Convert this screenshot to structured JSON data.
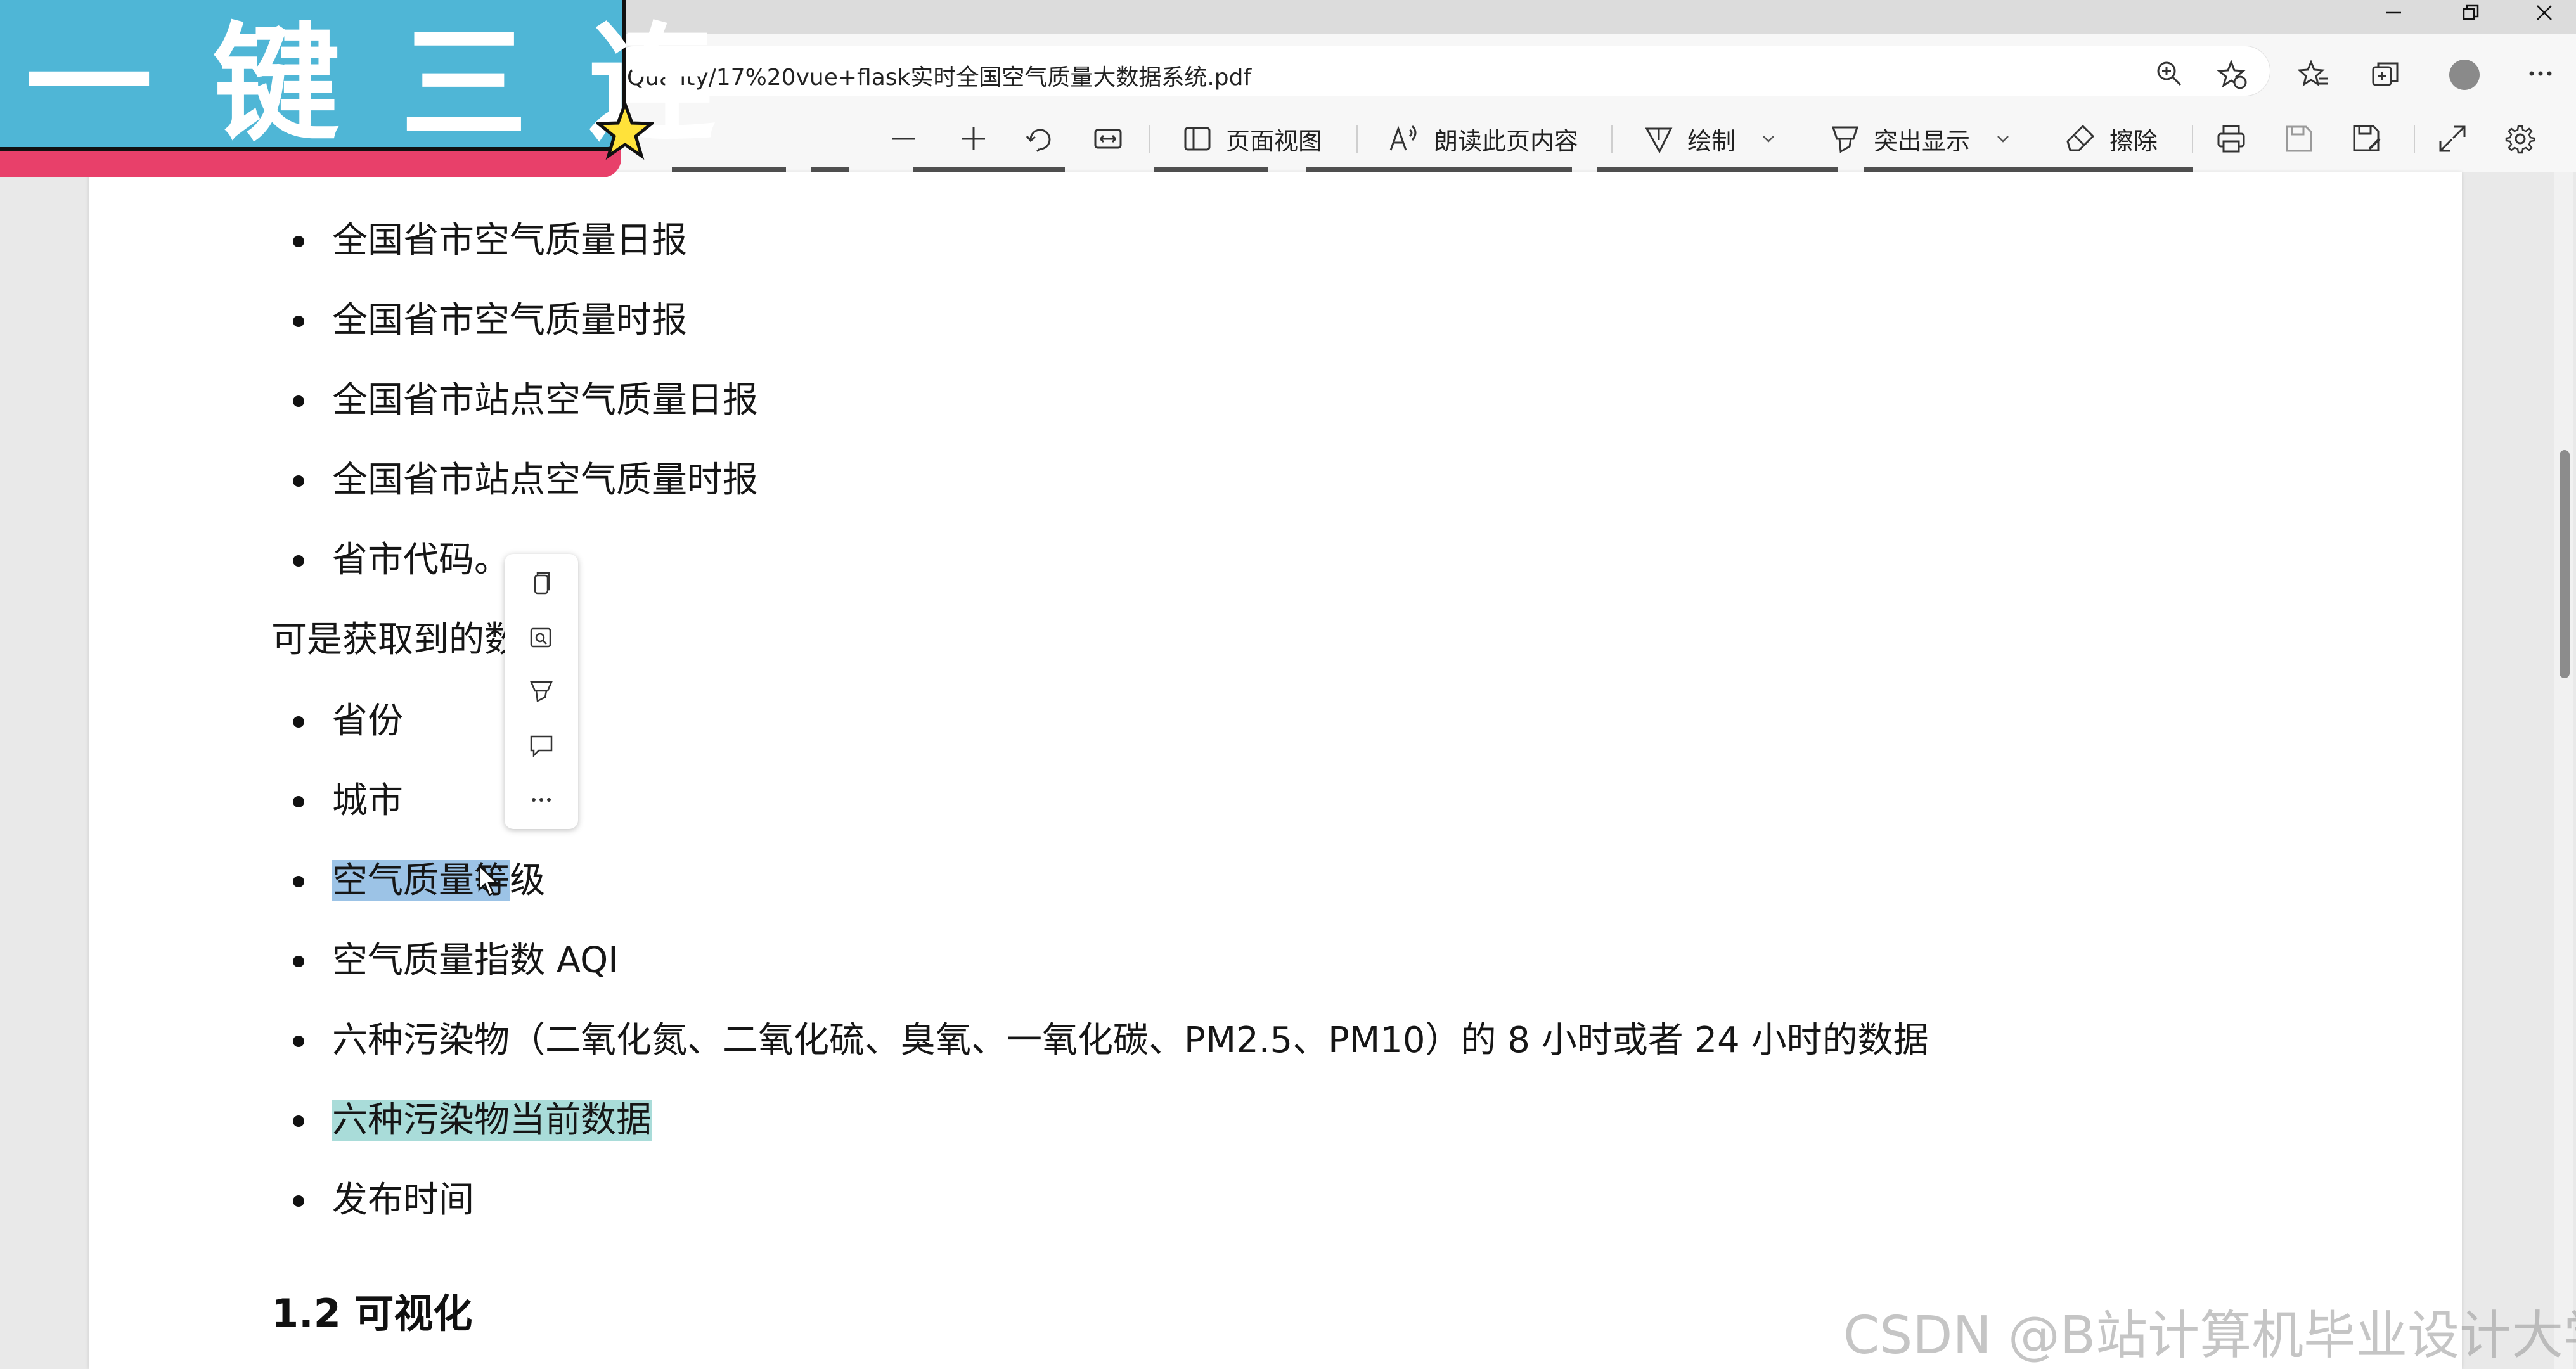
{
  "window": {
    "url": "Quality/17%20vue+flask实时全国空气质量大数据系统.pdf"
  },
  "toolbar": {
    "page_view": "页面视图",
    "read_aloud": "朗读此页内容",
    "draw": "绘制",
    "highlight": "突出显示",
    "erase": "擦除"
  },
  "document": {
    "sources": [
      "全国省市空气质量日报",
      "全国省市空气质量时报",
      "全国省市站点空气质量日报",
      "全国省市站点空气质量时报",
      "省市代码。"
    ],
    "para": "可是获取到的数",
    "fields": {
      "province": "省份",
      "city": "城市",
      "level_hl": "空气质量等",
      "level_rest": "级",
      "aqi": "空气质量指数 AQI",
      "pollutants": "六种污染物（二氧化氮、二氧化硫、臭氧、一氧化碳、PM2.5、PM10）的 8 小时或者 24 小时的数据",
      "current": "六种污染物当前数据",
      "publish_time": "发布时间"
    },
    "heading": "1.2 可视化"
  },
  "overlay": {
    "banner": "一键三连",
    "watermark": "CSDN @B站计算机毕业设计大学"
  },
  "colors": {
    "banner_blue": "#4fb6d6",
    "banner_pink": "#e8406a",
    "highlight_blue": "#9cc3e6",
    "highlight_teal": "#a9dcd9"
  }
}
